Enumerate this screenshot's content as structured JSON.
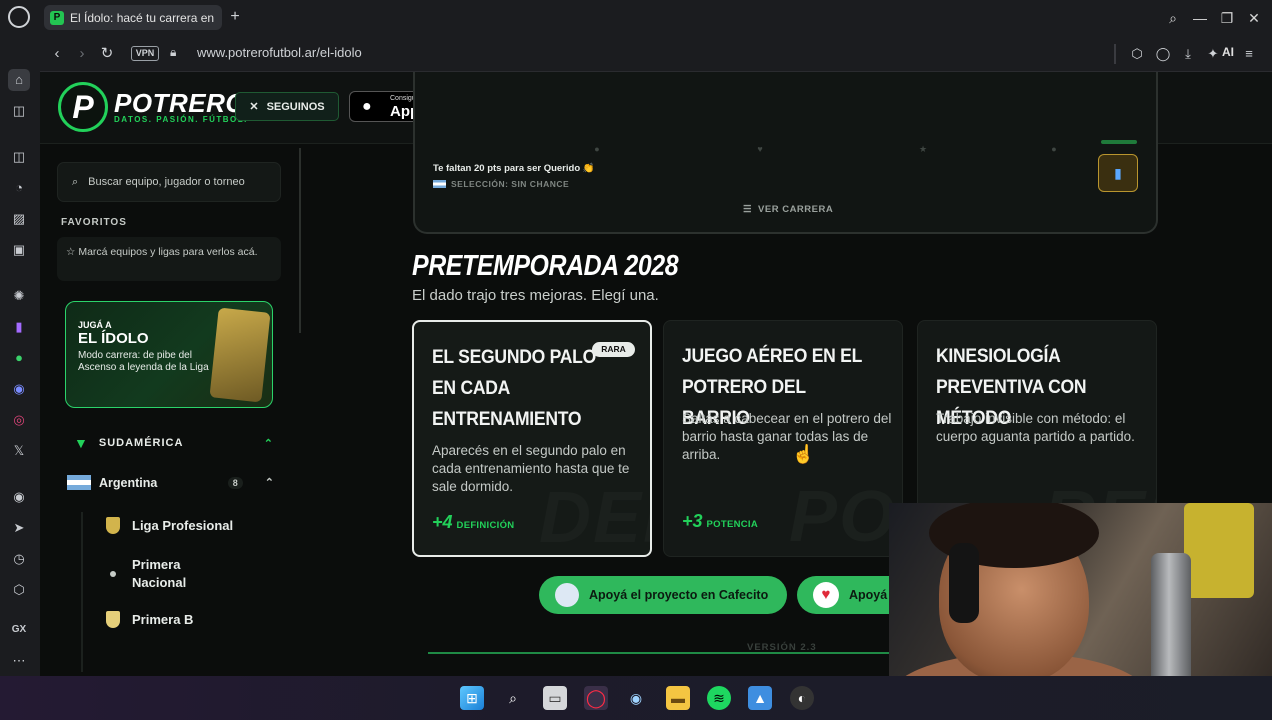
{
  "browser": {
    "tab_title": "El Ídolo: hacé tu carrera en",
    "new_tab": "+",
    "vpn": "VPN",
    "url": "www.potrerofutbol.ar/el-idolo",
    "ai_label": "AI"
  },
  "header": {
    "brand": "POTRERO",
    "tagline": "DATOS. PASIÓN. FÚTBOL.",
    "follow_label": "SEGUINOS",
    "appstore_small": "Consiguelo en el",
    "appstore_big": "App Store"
  },
  "sidebar": {
    "search_placeholder": "Buscar equipo, jugador o torneo",
    "favorites_title": "FAVORITOS",
    "favorites_hint": "Marcá equipos y ligas para verlos acá.",
    "promo_line1": "JUGÁ A",
    "promo_line2": "EL ÍDOLO",
    "promo_line3": "Modo carrera: de pibe del Ascenso a leyenda de la Liga",
    "region": "SUDAMÉRICA",
    "country": "Argentina",
    "country_count": "8",
    "leagues": [
      "Liga Profesional",
      "Primera Nacional",
      "Primera B"
    ]
  },
  "career": {
    "points_text": "Te faltan 20 pts para ser Querido 👏",
    "selection_text": "SELECCIÓN: SIN CHANCE",
    "view_career": "VER CARRERA"
  },
  "season": {
    "title": "PRETEMPORADA 2028",
    "subtitle": "El dado trajo tres mejoras. Elegí una."
  },
  "options": [
    {
      "title": "EL SEGUNDO PALO EN CADA ENTRENAMIENTO",
      "badge": "RARA",
      "description": "Aparecés en el segundo palo en cada entrenamiento hasta que te sale dormido.",
      "gain_value": "+4",
      "gain_label": "DEFINICIÓN",
      "bg_word": "DEF"
    },
    {
      "title": "JUEGO AÉREO EN EL POTRERO DEL BARRIO",
      "description": "Saltás a cabecear en el potrero del barrio hasta ganar todas las de arriba.",
      "gain_value": "+3",
      "gain_label": "POTENCIA",
      "bg_word": "POT"
    },
    {
      "title": "KINESIOLOGÍA PREVENTIVA CON MÉTODO",
      "description": "Trabajo invisible con método: el cuerpo aguanta partido a partido.",
      "bg_word": "RES"
    }
  ],
  "support": {
    "cafecito": "Apoyá el proyecto en Cafecito",
    "other": "Apoyá"
  },
  "footer": {
    "version": "VERSIÓN 2.3"
  },
  "opera_sidebar": {
    "gx_label": "GX",
    "more_label": "⋯"
  },
  "colors": {
    "accent": "#22d15a",
    "background": "#0b0d0c",
    "card": "#141816"
  },
  "icons": [
    "opera-icon",
    "back-icon",
    "forward-icon",
    "reload-icon",
    "lock-icon",
    "search-icon",
    "star-icon",
    "chevron-up-icon",
    "list-icon",
    "trophy-icon",
    "x-logo-icon",
    "apple-icon",
    "heart-icon",
    "windows-icon"
  ]
}
